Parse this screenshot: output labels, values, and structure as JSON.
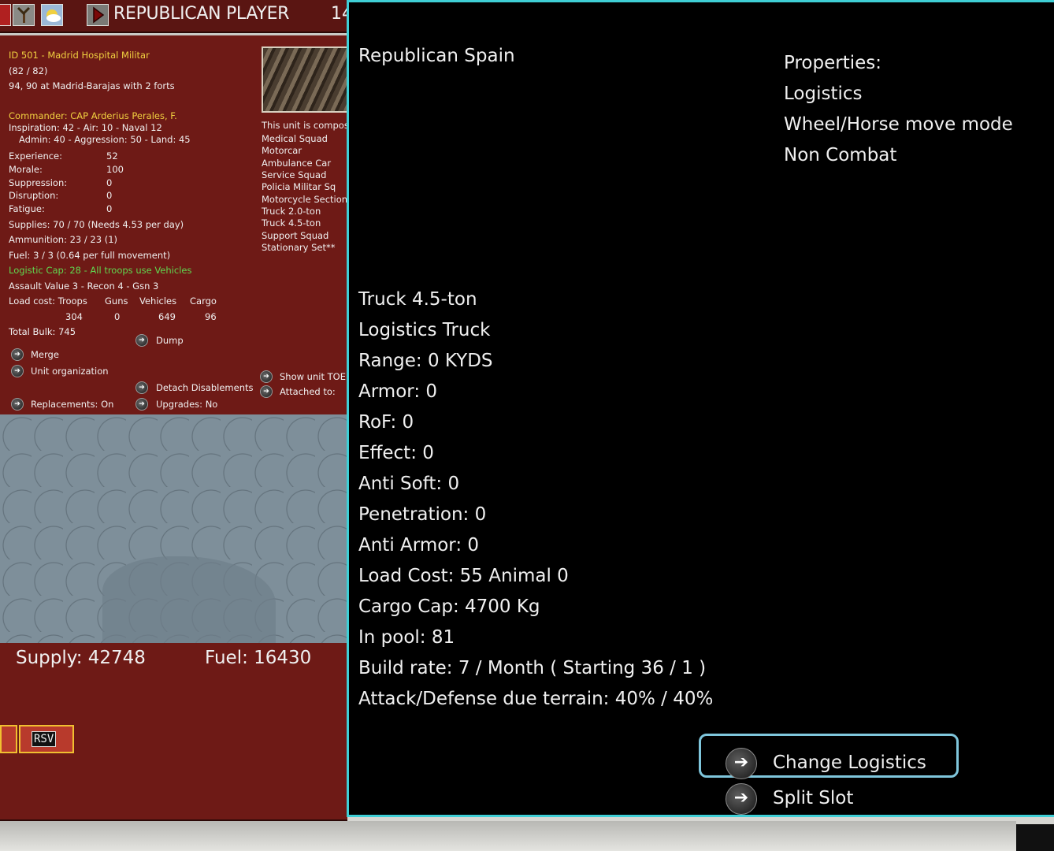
{
  "topbar": {
    "player_title": "REPUBLICAN PLAYER",
    "turn_fragment": "14"
  },
  "unit": {
    "id_line": "ID 501 - Madrid Hospital Militar",
    "strength": "(82 / 82)",
    "location": "94, 90 at Madrid-Barajas with 2 forts",
    "commander": "Commander: CAP Arderius Perales, F.",
    "ratings_1": "Inspiration: 42 - Air: 10 - Naval 12",
    "ratings_2": "Admin: 40 - Aggression: 50 - Land: 45",
    "stats": [
      {
        "label": "Experience:",
        "value": "52"
      },
      {
        "label": "Morale:",
        "value": "100"
      },
      {
        "label": "Suppression:",
        "value": "0"
      },
      {
        "label": "Disruption:",
        "value": "0"
      },
      {
        "label": "Fatigue:",
        "value": "0"
      }
    ],
    "supplies": "Supplies: 70 / 70 (Needs 4.53 per day)",
    "ammunition": "Ammunition: 23 / 23 (1)",
    "fuel": "Fuel: 3 / 3 (0.64 per full movement)",
    "logistic_cap": "Logistic Cap: 28 - All troops use Vehicles",
    "assault": "Assault Value 3 - Recon 4 - Gsn 3",
    "load_cost_label": "Load cost: Troops",
    "load_headers": [
      "Guns",
      "Vehicles",
      "Cargo"
    ],
    "load_values": [
      "304",
      "0",
      "649",
      "96"
    ],
    "total_bulk": "Total Bulk: 745",
    "composition_intro": "This unit is compos",
    "composition": [
      "Medical Squad",
      "Motorcar",
      "Ambulance Car",
      "Service Squad",
      "Policia Militar Sq",
      "Motorcycle Section",
      "Truck 2.0-ton",
      "Truck 4.5-ton",
      "Support Squad",
      "Stationary Set**"
    ],
    "actions": {
      "dump": "Dump",
      "merge": "Merge",
      "unit_org": "Unit organization",
      "detach": "Detach Disablements",
      "show_toe": "Show unit TOE",
      "attached": "Attached to:",
      "replacements": "Replacements: On",
      "upgrades": "Upgrades: No"
    }
  },
  "bottom": {
    "supply": "Supply: 42748",
    "fuel": "Fuel: 16430",
    "counter_label": "RSV"
  },
  "detail": {
    "nation": "Republican Spain",
    "properties_title": "Properties:",
    "properties": [
      "Logistics",
      "Wheel/Horse move mode",
      "Non Combat"
    ],
    "lines": [
      "Truck 4.5-ton",
      "Logistics Truck",
      "Range: 0 KYDS",
      "Armor: 0",
      "RoF: 0",
      "Effect: 0",
      "Anti Soft: 0",
      "Penetration: 0",
      "Anti Armor: 0",
      "Load Cost: 55 Animal 0",
      "Cargo Cap: 4700 Kg",
      "In pool: 81",
      "Build rate: 7 / Month ( Starting 36 / 1 )",
      "Attack/Defense due terrain: 40% / 40%"
    ],
    "change_logistics": "Change Logistics",
    "split_slot": "Split Slot"
  },
  "colors": {
    "panel_red": "#6e1a16",
    "accent_cyan": "#3fcfd6",
    "highlight_blue": "#7fc6dc",
    "yellow_text": "#f0d040",
    "green_text": "#60d850"
  }
}
